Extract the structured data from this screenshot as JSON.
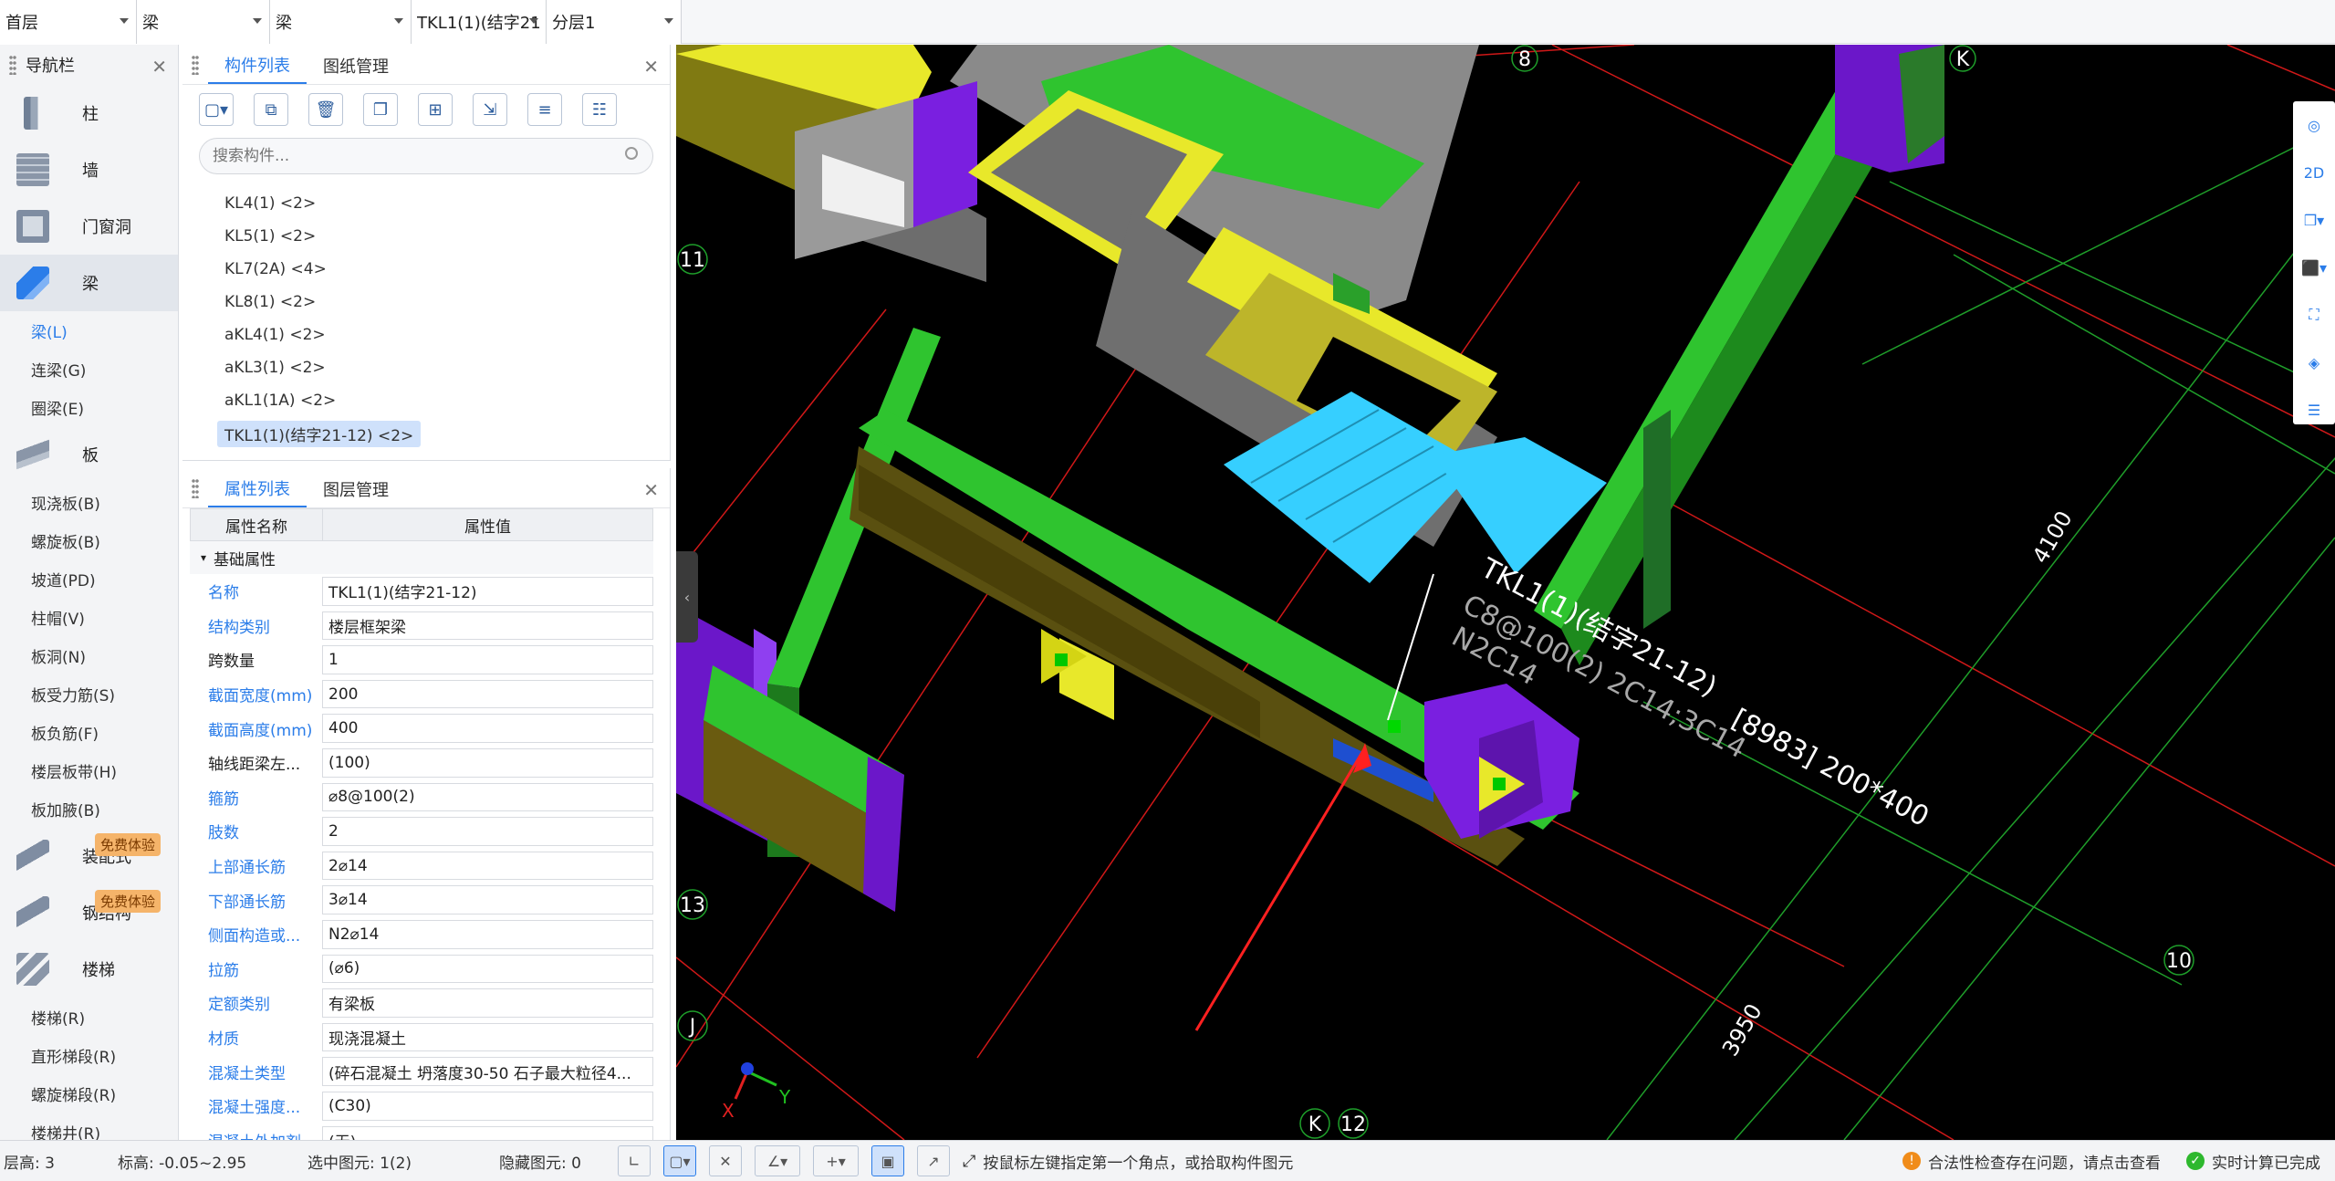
{
  "selectors": [
    {
      "value": "首层"
    },
    {
      "value": "梁"
    },
    {
      "value": "梁"
    },
    {
      "value": "TKL1(1)(结字21"
    },
    {
      "value": "分层1"
    }
  ],
  "nav": {
    "title": "导航栏",
    "big_items": [
      {
        "label": "柱"
      },
      {
        "label": "墙"
      },
      {
        "label": "门窗洞"
      },
      {
        "label": "梁"
      }
    ],
    "beam_subitems": [
      {
        "label": "梁(L)"
      },
      {
        "label": "连梁(G)"
      },
      {
        "label": "圈梁(E)"
      }
    ],
    "slab": {
      "label": "板"
    },
    "slab_subitems": [
      {
        "label": "现浇板(B)"
      },
      {
        "label": "螺旋板(B)"
      },
      {
        "label": "坡道(PD)"
      },
      {
        "label": "柱帽(V)"
      },
      {
        "label": "板洞(N)"
      },
      {
        "label": "板受力筋(S)"
      },
      {
        "label": "板负筋(F)"
      },
      {
        "label": "楼层板带(H)"
      },
      {
        "label": "板加腋(B)"
      }
    ],
    "promo_items": [
      {
        "label": "装配式 ",
        "badge": "免费体验"
      },
      {
        "label": "钢结构 ",
        "badge": "免费体验"
      }
    ],
    "stair": {
      "label": "楼梯"
    },
    "stair_subitems": [
      {
        "label": "楼梯(R)"
      },
      {
        "label": "直形梯段(R)"
      },
      {
        "label": "螺旋梯段(R)"
      },
      {
        "label": "楼梯井(R)"
      }
    ]
  },
  "component_panel": {
    "tabs": [
      "构件列表",
      "图纸管理"
    ],
    "search_placeholder": "搜索构件...",
    "items": [
      {
        "label": "KL4(1)  <2>"
      },
      {
        "label": "KL5(1)  <2>"
      },
      {
        "label": "KL7(2A)  <4>"
      },
      {
        "label": "KL8(1)  <2>"
      },
      {
        "label": "aKL4(1)  <2>"
      },
      {
        "label": "aKL3(1)  <2>"
      },
      {
        "label": "aKL1(1A)  <2>"
      },
      {
        "label": "TKL1(1)(结字21-12)    <2>"
      }
    ]
  },
  "property_panel": {
    "tabs": [
      "属性列表",
      "图层管理"
    ],
    "header": {
      "name": "属性名称",
      "value": "属性值"
    },
    "group": "基础属性",
    "rows": [
      {
        "name": "名称",
        "value": "TKL1(1)(结字21-12)"
      },
      {
        "name": "结构类别",
        "value": "楼层框架梁"
      },
      {
        "name": "跨数量",
        "value": "1"
      },
      {
        "name": "截面宽度(mm)",
        "value": "200"
      },
      {
        "name": "截面高度(mm)",
        "value": "400"
      },
      {
        "name": "轴线距梁左...",
        "value": "(100)"
      },
      {
        "name": "箍筋",
        "value": "⌀8@100(2)"
      },
      {
        "name": "肢数",
        "value": "2"
      },
      {
        "name": "上部通长筋",
        "value": "2⌀14"
      },
      {
        "name": "下部通长筋",
        "value": "3⌀14"
      },
      {
        "name": "侧面构造或...",
        "value": "N2⌀14"
      },
      {
        "name": "拉筋",
        "value": "(⌀6)"
      },
      {
        "name": "定额类别",
        "value": "有梁板"
      },
      {
        "name": "材质",
        "value": "现浇混凝土"
      },
      {
        "name": "混凝土类型",
        "value": "(碎石混凝土 坍落度30-50 石子最大粒径4..."
      },
      {
        "name": "混凝土强度...",
        "value": "(C30)"
      },
      {
        "name": "混凝土外加剂",
        "value": "(无)"
      }
    ]
  },
  "view3d": {
    "axis_labels": [
      "8",
      "K",
      "11",
      "13",
      "J",
      "K",
      "12",
      "10"
    ],
    "dims": [
      "4100",
      "3950"
    ],
    "beam_label": {
      "line1": "TKL1(1)(结字21-12)",
      "line2": "C8@100(2) 2C14;3C14",
      "line3": "N2C14",
      "line4": "[8983] 200*400"
    },
    "axes": {
      "x": "X",
      "y": "Y"
    }
  },
  "status": {
    "floor_height": "层高:  3",
    "elevation": "标高:  -0.05~2.95",
    "selected": "选中图元:  1(2)",
    "hidden": "隐藏图元:  0",
    "hint": "按鼠标左键指定第一个角点，或拾取构件图元",
    "check": "合法性检查存在问题，请点击查看",
    "calc": "实时计算已完成"
  },
  "colors": {
    "accent": "#2b7de9",
    "beam_green": "#2fc42f",
    "column_purple": "#7a1fe0",
    "wall_yellow": "#e8e82a",
    "slab_cyan": "#36cfff",
    "olive": "#807a12"
  }
}
